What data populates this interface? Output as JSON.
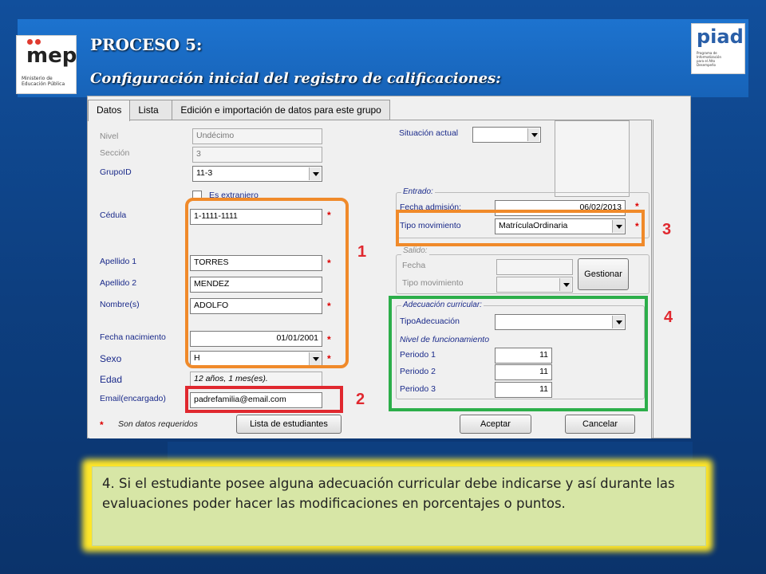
{
  "header": {
    "title": "PROCESO 5:",
    "subtitle": "Configuración inicial del registro de calificaciones:",
    "logo_left": "mep",
    "logo_left_sub": "Ministerio de Educación Pública",
    "logo_right": "piad",
    "logo_right_sub": "Programa de Informatización para el Alto Desempeño"
  },
  "tabs": [
    {
      "label": "Datos",
      "active": true
    },
    {
      "label": "Lista",
      "active": false
    },
    {
      "label": "Edición e importación de datos para este grupo",
      "active": false
    }
  ],
  "form": {
    "nivel": {
      "label": "Nivel",
      "value": "Undécimo"
    },
    "seccion": {
      "label": "Sección",
      "value": "3"
    },
    "grupoid": {
      "label": "GrupoID",
      "value": "11-3"
    },
    "es_extranjero": {
      "label": "Es extranjero"
    },
    "cedula": {
      "label": "Cédula",
      "value": "1-1111-1111"
    },
    "apellido1": {
      "label": "Apellido 1",
      "value": "TORRES"
    },
    "apellido2": {
      "label": "Apellido 2",
      "value": "MENDEZ"
    },
    "nombre": {
      "label": "Nombre(s)",
      "value": "ADOLFO"
    },
    "fecha_nac": {
      "label": "Fecha nacimiento",
      "value": "01/01/2001"
    },
    "sexo": {
      "label": "Sexo",
      "value": "H"
    },
    "edad": {
      "label": "Edad",
      "value": "12 años, 1 mes(es)."
    },
    "email": {
      "label": "Email(encargado)",
      "value": "padrefamilia@email.com"
    },
    "required_note": "Son datos requeridos",
    "required_star": "*",
    "situacion": {
      "label": "Situación actual",
      "value": ""
    },
    "entrado": {
      "group_label": "Entrado:",
      "fecha_label": "Fecha admisión:",
      "fecha_value": "06/02/2013",
      "tipo_label": "Tipo movimiento",
      "tipo_value": "MatrículaOrdinaria"
    },
    "salido": {
      "group_label": "Salido:",
      "fecha_label": "Fecha",
      "tipo_label": "Tipo movimiento"
    },
    "adecuacion": {
      "group_label": "Adecuación curricular:",
      "tipo_label": "TipoAdecuación",
      "nivel_label": "Nivel de funcionamiento",
      "periodos": [
        {
          "label": "Periodo 1",
          "value": "11"
        },
        {
          "label": "Periodo 2",
          "value": "11"
        },
        {
          "label": "Periodo 3",
          "value": "11"
        }
      ]
    }
  },
  "buttons": {
    "gestionar": "Gestionar",
    "lista": "Lista de estudiantes",
    "aceptar": "Aceptar",
    "cancelar": "Cancelar"
  },
  "callouts": [
    "1",
    "2",
    "3",
    "4"
  ],
  "note": "4. Si el estudiante posee alguna adecuación curricular debe indicarse y así durante las evaluaciones poder hacer las modificaciones en porcentajes o puntos.",
  "colors": {
    "orange": "#f08a2a",
    "red": "#e0282f",
    "green": "#2cae4a",
    "note_bg": "#d7e6a6",
    "glow": "#ffe629"
  }
}
